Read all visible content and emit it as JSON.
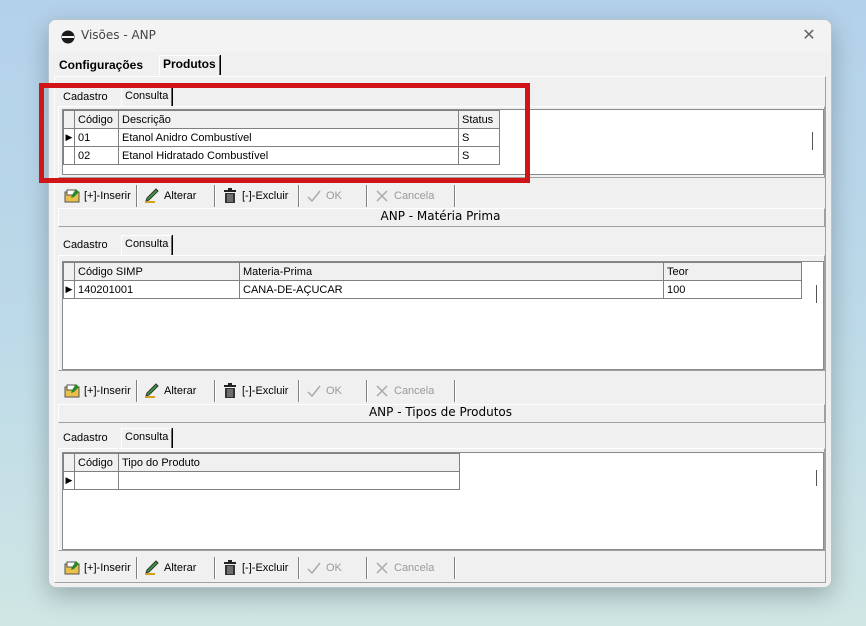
{
  "window": {
    "title": "Visões - ANP"
  },
  "main_tabs": [
    "Configurações",
    "Produtos"
  ],
  "sub_tabs": [
    "Cadastro",
    "Consulta"
  ],
  "produtos": {
    "columns": [
      "Código",
      "Descrição",
      "Status"
    ],
    "rows": [
      {
        "codigo": "01",
        "descricao": "Etanol Anidro Combustível",
        "status": "S"
      },
      {
        "codigo": "02",
        "descricao": "Etanol Hidratado Combustível",
        "status": "S"
      }
    ]
  },
  "materia_prima": {
    "title": "ANP - Matéria Prima",
    "columns": [
      "Código SIMP",
      "Materia-Prima",
      "Teor"
    ],
    "rows": [
      {
        "codigo": "140201001",
        "materia": "CANA-DE-AÇUCAR",
        "teor": "100"
      }
    ]
  },
  "tipos_produtos": {
    "title": "ANP - Tipos de Produtos",
    "columns": [
      "Código",
      "Tipo do Produto"
    ]
  },
  "toolbar": {
    "insert": "[+]-Inserir",
    "edit": "Alterar",
    "delete": "[-]-Excluir",
    "ok": "OK",
    "cancel": "Cancela"
  },
  "colors": {
    "highlight": "#d01418"
  }
}
